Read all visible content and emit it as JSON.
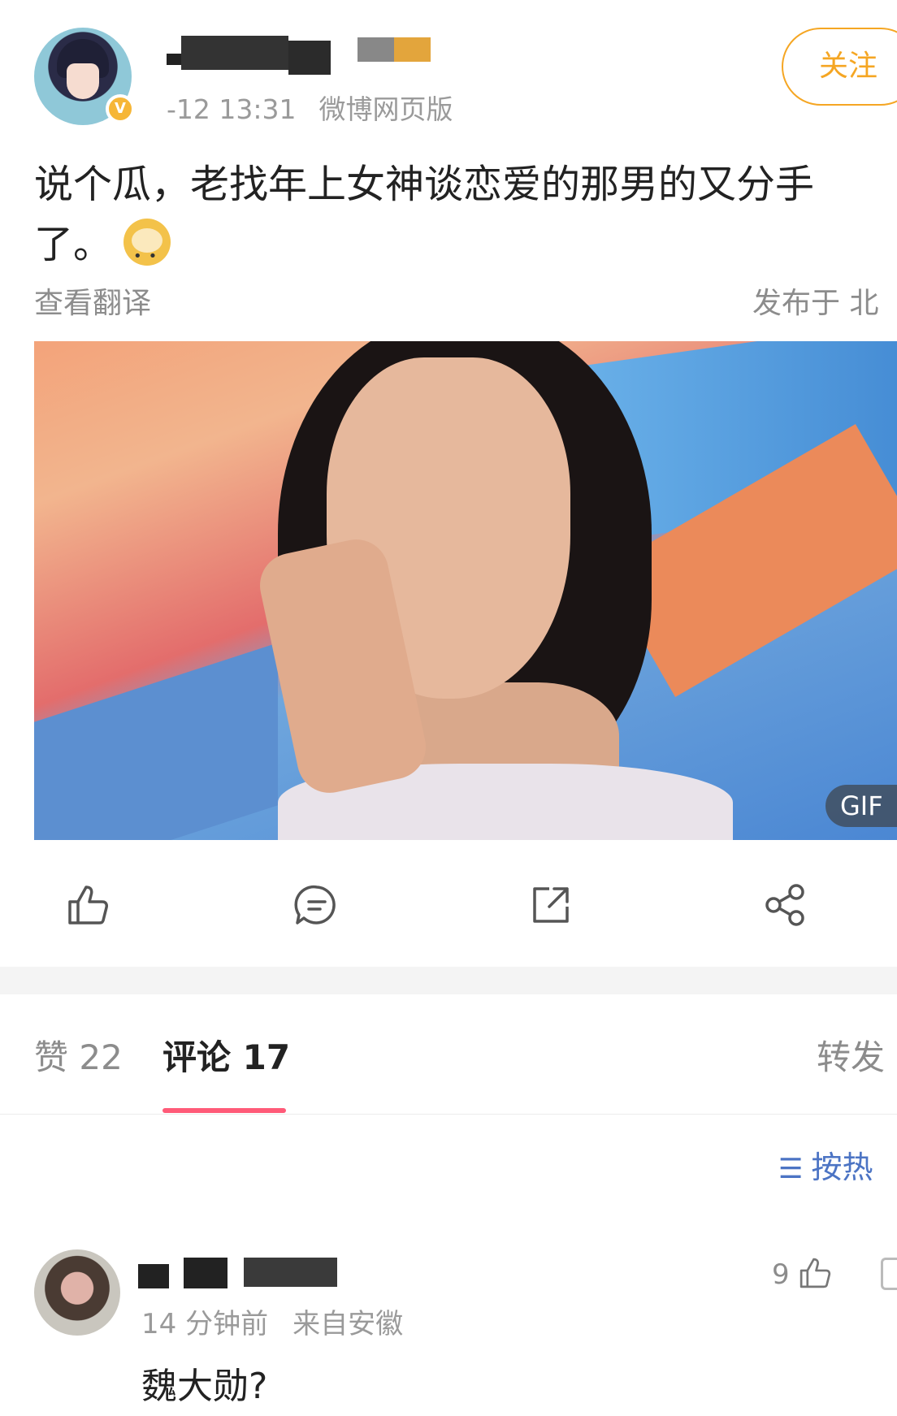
{
  "post": {
    "time": "-12 13:31",
    "source": "微博网页版",
    "follow_label": "关注",
    "text": "说个瓜，老找年上女神谈恋爱的那男的又分手了。",
    "translate_label": "查看翻译",
    "location_label": "发布于 北",
    "image_badge": "GIF"
  },
  "actions": {
    "like_icon": "thumbs-up-icon",
    "comment_icon": "comment-icon",
    "repost_icon": "repost-icon",
    "share_icon": "share-icon"
  },
  "tabs": {
    "likes_label": "赞 22",
    "comments_label": "评论 17",
    "reposts_label": "转发"
  },
  "sort": {
    "label": "按热"
  },
  "comment": {
    "time": "14 分钟前",
    "location": "来自安徽",
    "like_count": "9",
    "text": "魏大勋?"
  },
  "colors": {
    "accent_orange": "#f5a623",
    "tab_indicator": "#ff5a78",
    "link_blue": "#4c74c4"
  }
}
